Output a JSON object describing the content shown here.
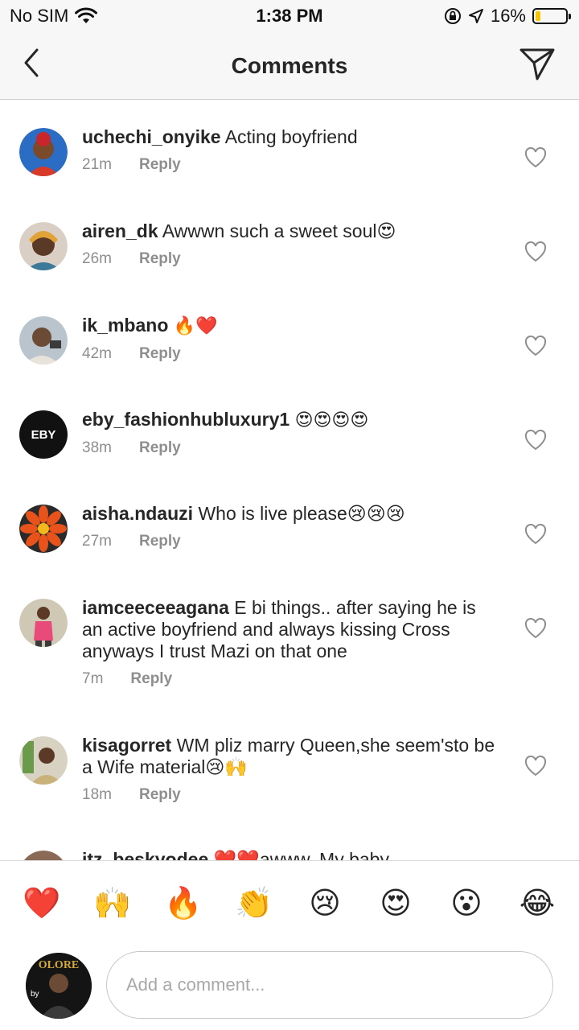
{
  "status_bar": {
    "carrier": "No SIM",
    "time": "1:38 PM",
    "battery_percent": "16%",
    "battery_level": 0.16,
    "battery_color": "#f5c400"
  },
  "header": {
    "title": "Comments",
    "back_icon": "chevron-left-icon",
    "share_icon": "paper-plane-icon"
  },
  "comments": [
    {
      "username": "uchechi_onyike",
      "text": "Acting boyfriend",
      "time": "21m",
      "reply": "Reply"
    },
    {
      "username": "airen_dk",
      "text": "Awwwn such a sweet soul😍",
      "time": "26m",
      "reply": "Reply"
    },
    {
      "username": "ik_mbano",
      "text": "🔥❤️",
      "time": "42m",
      "reply": "Reply"
    },
    {
      "username": "eby_fashionhubluxury1",
      "text": "😍😍😍😍",
      "time": "38m",
      "reply": "Reply",
      "avatar_text": "EBY"
    },
    {
      "username": "aisha.ndauzi",
      "text": "Who is live please😢😢😢",
      "time": "27m",
      "reply": "Reply"
    },
    {
      "username": "iamceeceeagana",
      "text": "E bi things.. after saying he is an active boyfriend and always kissing Cross anyways I trust Mazi on that one",
      "time": "7m",
      "reply": "Reply"
    },
    {
      "username": "kisagorret",
      "text": "WM pliz marry Queen,she seem'sto be a Wife material😢🙌",
      "time": "18m",
      "reply": "Reply"
    },
    {
      "username": "itz_beskyodee",
      "text": "❤️❤️awww. My baby",
      "time": "",
      "reply": ""
    }
  ],
  "emoji_bar": [
    "❤️",
    "🙌",
    "🔥",
    "👏",
    "😢",
    "😍",
    "😮",
    "😂"
  ],
  "composer": {
    "placeholder": "Add a comment...",
    "avatar_text_top": "OLORE",
    "avatar_text_bottom": "by"
  }
}
